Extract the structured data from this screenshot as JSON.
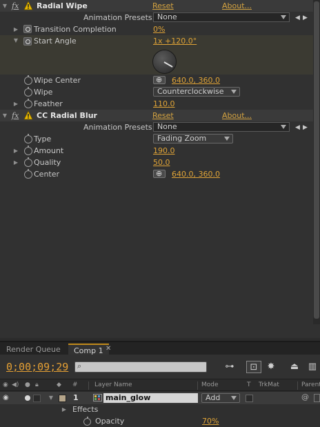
{
  "effects": [
    {
      "name": "Radial Wipe",
      "reset": "Reset",
      "about": "About...",
      "presets_label": "Animation Presets:",
      "preset_value": "None",
      "props": {
        "transition_label": "Transition Completion",
        "transition_value": "0%",
        "angle_label": "Start Angle",
        "angle_value": "1x +120.0°",
        "center_label": "Wipe Center",
        "center_value": "640.0, 360.0",
        "wipe_label": "Wipe",
        "wipe_value": "Counterclockwise",
        "feather_label": "Feather",
        "feather_value": "110.0"
      }
    },
    {
      "name": "CC Radial Blur",
      "reset": "Reset",
      "about": "About...",
      "presets_label": "Animation Presets:",
      "preset_value": "None",
      "props": {
        "type_label": "Type",
        "type_value": "Fading Zoom",
        "amount_label": "Amount",
        "amount_value": "190.0",
        "quality_label": "Quality",
        "quality_value": "50.0",
        "center_label": "Center",
        "center_value": "640.0, 360.0"
      }
    }
  ],
  "tabs": [
    "Render Queue",
    "Comp 1"
  ],
  "timeline": {
    "timecode": "0;00;09;29",
    "columns": {
      "hash": "#",
      "layer_name": "Layer Name",
      "mode": "Mode",
      "t": "T",
      "trkmat": "TrkMat",
      "parent": "Parent"
    },
    "layer": {
      "number": "1",
      "name": "main_glow",
      "mode": "Add",
      "label_color": "#b5a58a"
    },
    "effects_label": "Effects",
    "opacity_label": "Opacity",
    "opacity_value": "70%"
  },
  "colors": {
    "accent_value": "#e0a437",
    "panel_bg": "#313131",
    "tab_active_line": "#c08a1a"
  },
  "icons": {
    "fx": "fx",
    "warning": "warning-triangle-icon",
    "stopwatch": "stopwatch-icon",
    "target": "crosshair-icon"
  }
}
